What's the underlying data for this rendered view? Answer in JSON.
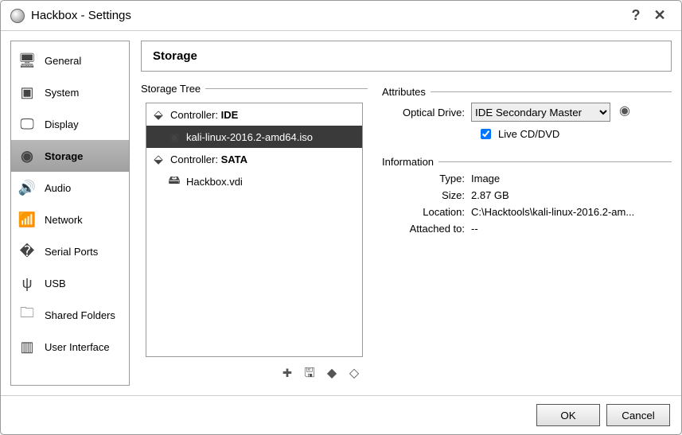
{
  "window": {
    "title": "Hackbox - Settings"
  },
  "sidebar": {
    "items": [
      {
        "label": "General",
        "icon": "monitor-icon"
      },
      {
        "label": "System",
        "icon": "chip-icon"
      },
      {
        "label": "Display",
        "icon": "display-icon"
      },
      {
        "label": "Storage",
        "icon": "disk-icon",
        "selected": true
      },
      {
        "label": "Audio",
        "icon": "audio-icon"
      },
      {
        "label": "Network",
        "icon": "network-icon"
      },
      {
        "label": "Serial Ports",
        "icon": "serial-icon"
      },
      {
        "label": "USB",
        "icon": "usb-icon"
      },
      {
        "label": "Shared Folders",
        "icon": "folder-icon"
      },
      {
        "label": "User Interface",
        "icon": "interface-icon"
      }
    ]
  },
  "header": {
    "title": "Storage"
  },
  "storage_tree": {
    "label": "Storage Tree",
    "controller_prefix": "Controller: ",
    "controllers": [
      {
        "name": "IDE",
        "items": [
          {
            "label": "kali-linux-2016.2-amd64.iso",
            "icon": "disc",
            "selected": true
          }
        ]
      },
      {
        "name": "SATA",
        "items": [
          {
            "label": "Hackbox.vdi",
            "icon": "hdd"
          }
        ]
      }
    ]
  },
  "attributes": {
    "label": "Attributes",
    "optical_drive_label": "Optical Drive:",
    "optical_drive_value": "IDE Secondary Master",
    "live_cd_label": "Live CD/DVD",
    "live_cd_checked": true
  },
  "information": {
    "label": "Information",
    "rows": {
      "type_label": "Type:",
      "type_value": "Image",
      "size_label": "Size:",
      "size_value": "2.87 GB",
      "location_label": "Location:",
      "location_value": "C:\\Hacktools\\kali-linux-2016.2-am...",
      "attached_label": "Attached to:",
      "attached_value": "--"
    }
  },
  "footer": {
    "ok": "OK",
    "cancel": "Cancel"
  }
}
